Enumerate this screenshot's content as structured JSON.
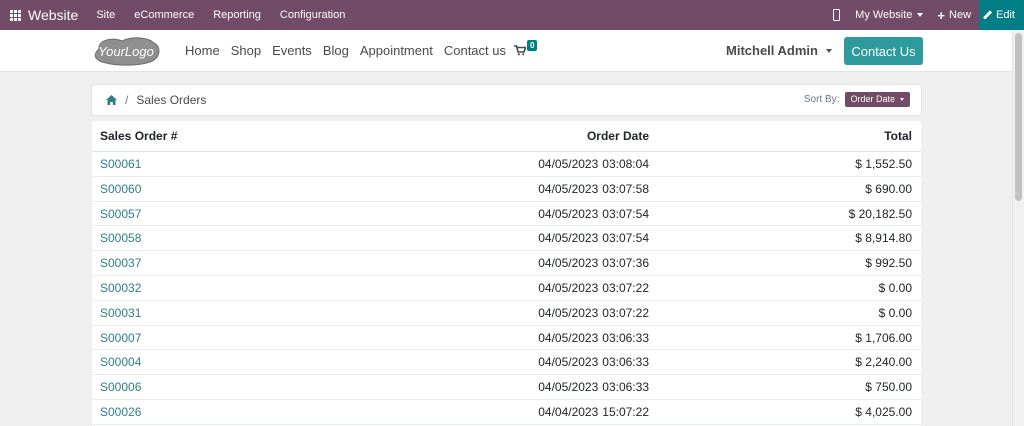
{
  "admin_bar": {
    "app_name": "Website",
    "menu": [
      "Site",
      "eCommerce",
      "Reporting",
      "Configuration"
    ],
    "site_selector": "My Website",
    "new_label": "New",
    "edit_label": "Edit"
  },
  "header": {
    "logo_text": "YourLogo",
    "nav": [
      "Home",
      "Shop",
      "Events",
      "Blog",
      "Appointment",
      "Contact us"
    ],
    "cart_count": "0",
    "user_name": "Mitchell Admin",
    "contact_button": "Contact Us"
  },
  "breadcrumb": {
    "separator": "/",
    "current": "Sales Orders"
  },
  "sort": {
    "label": "Sort By:",
    "value": "Order Date"
  },
  "table": {
    "headers": {
      "order": "Sales Order #",
      "date": "Order Date",
      "total": "Total"
    },
    "rows": [
      {
        "order": "S00061",
        "date": "04/05/2023",
        "time": "03:08:04",
        "total": "$ 1,552.50"
      },
      {
        "order": "S00060",
        "date": "04/05/2023",
        "time": "03:07:58",
        "total": "$ 690.00"
      },
      {
        "order": "S00057",
        "date": "04/05/2023",
        "time": "03:07:54",
        "total": "$ 20,182.50"
      },
      {
        "order": "S00058",
        "date": "04/05/2023",
        "time": "03:07:54",
        "total": "$ 8,914.80"
      },
      {
        "order": "S00037",
        "date": "04/05/2023",
        "time": "03:07:36",
        "total": "$ 992.50"
      },
      {
        "order": "S00032",
        "date": "04/05/2023",
        "time": "03:07:22",
        "total": "$ 0.00"
      },
      {
        "order": "S00031",
        "date": "04/05/2023",
        "time": "03:07:22",
        "total": "$ 0.00"
      },
      {
        "order": "S00007",
        "date": "04/05/2023",
        "time": "03:06:33",
        "total": "$ 1,706.00"
      },
      {
        "order": "S00004",
        "date": "04/05/2023",
        "time": "03:06:33",
        "total": "$ 2,240.00"
      },
      {
        "order": "S00006",
        "date": "04/05/2023",
        "time": "03:06:33",
        "total": "$ 750.00"
      },
      {
        "order": "S00026",
        "date": "04/04/2023",
        "time": "15:07:22",
        "total": "$ 4,025.00"
      }
    ]
  },
  "colors": {
    "admin_bar": "#714b67",
    "edit_button": "#017e84",
    "contact_button": "#2d9b9e",
    "order_link": "#2f7f8a",
    "page_background": "#efefef"
  }
}
